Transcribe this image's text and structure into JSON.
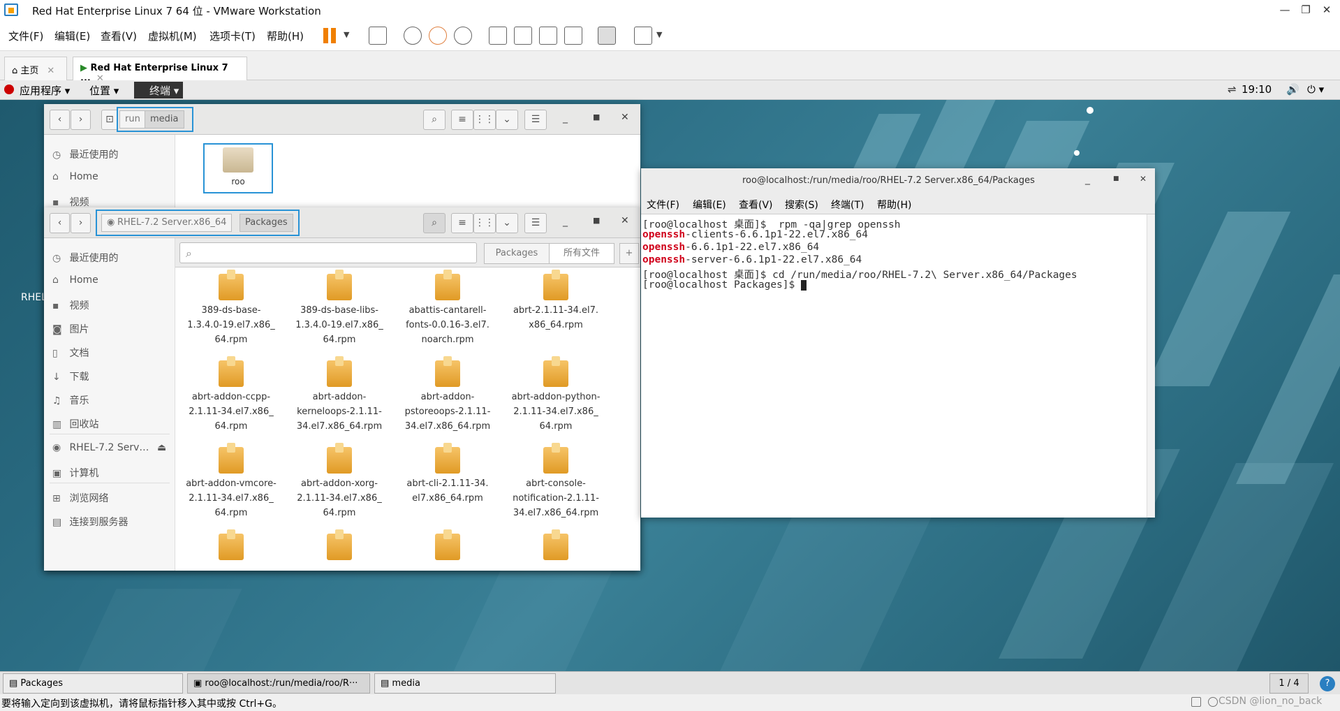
{
  "vm": {
    "title": "Red Hat Enterprise Linux 7 64 位 - VMware Workstation",
    "menus": [
      "文件(F)",
      "编辑(E)",
      "查看(V)",
      "虚拟机(M)",
      "选项卡(T)",
      "帮助(H)"
    ],
    "tabs": [
      "主页",
      "Red Hat Enterprise Linux 7 ..."
    ],
    "status_text": "要将输入定向到该虚拟机，请将鼠标指针移入其中或按 Ctrl+G。",
    "watermark": "CSDN @lion_no_back"
  },
  "gnome": {
    "apps": "应用程序",
    "places": "位置",
    "terminal": "终端",
    "clock": "19:10",
    "desktop_label": "RHEL"
  },
  "nautilus_media": {
    "crumbs": [
      "run",
      "media"
    ],
    "sidebar": [
      "最近使用的",
      "Home",
      "视频"
    ],
    "folder": "roo"
  },
  "nautilus_pkg": {
    "crumbs": [
      "RHEL-7.2 Server.x86_64",
      "Packages"
    ],
    "search_tabs": [
      "Packages",
      "所有文件"
    ],
    "sidebar": [
      "最近使用的",
      "Home",
      "视频",
      "图片",
      "文档",
      "下载",
      "音乐",
      "回收站",
      "RHEL-7.2 Serv…",
      "计算机",
      "浏览网络",
      "连接到服务器"
    ],
    "files": [
      [
        "389-ds-base-",
        "1.3.4.0-19.el7.x86_",
        "64.rpm"
      ],
      [
        "389-ds-base-libs-",
        "1.3.4.0-19.el7.x86_",
        "64.rpm"
      ],
      [
        "abattis-cantarell-",
        "fonts-0.0.16-3.el7.",
        "noarch.rpm"
      ],
      [
        "abrt-2.1.11-34.el7.",
        "x86_64.rpm"
      ],
      [
        "abrt-addon-ccpp-",
        "2.1.11-34.el7.x86_",
        "64.rpm"
      ],
      [
        "abrt-addon-",
        "kerneloops-2.1.11-",
        "34.el7.x86_64.rpm"
      ],
      [
        "abrt-addon-",
        "pstoreoops-2.1.11-",
        "34.el7.x86_64.rpm"
      ],
      [
        "abrt-addon-python-",
        "2.1.11-34.el7.x86_",
        "64.rpm"
      ],
      [
        "abrt-addon-vmcore-",
        "2.1.11-34.el7.x86_",
        "64.rpm"
      ],
      [
        "abrt-addon-xorg-",
        "2.1.11-34.el7.x86_",
        "64.rpm"
      ],
      [
        "abrt-cli-2.1.11-34.",
        "el7.x86_64.rpm"
      ],
      [
        "abrt-console-",
        "notification-2.1.11-",
        "34.el7.x86_64.rpm"
      ]
    ]
  },
  "terminal": {
    "title": "roo@localhost:/run/media/roo/RHEL-7.2 Server.x86_64/Packages",
    "menus": [
      "文件(F)",
      "编辑(E)",
      "查看(V)",
      "搜索(S)",
      "终端(T)",
      "帮助(H)"
    ],
    "lines": [
      {
        "pre": "[roo@localhost 桌面]$  rpm -qa|grep openssh",
        "red": "",
        "post": ""
      },
      {
        "pre": "",
        "red": "openssh",
        "post": "-clients-6.6.1p1-22.el7.x86_64"
      },
      {
        "pre": "",
        "red": "openssh",
        "post": "-6.6.1p1-22.el7.x86_64"
      },
      {
        "pre": "",
        "red": "openssh",
        "post": "-server-6.6.1p1-22.el7.x86_64"
      },
      {
        "pre": "[roo@localhost 桌面]$ cd /run/media/roo/RHEL-7.2\\ Server.x86_64/Packages",
        "red": "",
        "post": ""
      },
      {
        "pre": "[roo@localhost Packages]$ ",
        "red": "",
        "post": ""
      }
    ]
  },
  "taskbar": {
    "items": [
      "Packages",
      "roo@localhost:/run/media/roo/R···",
      "media"
    ],
    "workspace": "1 / 4"
  }
}
